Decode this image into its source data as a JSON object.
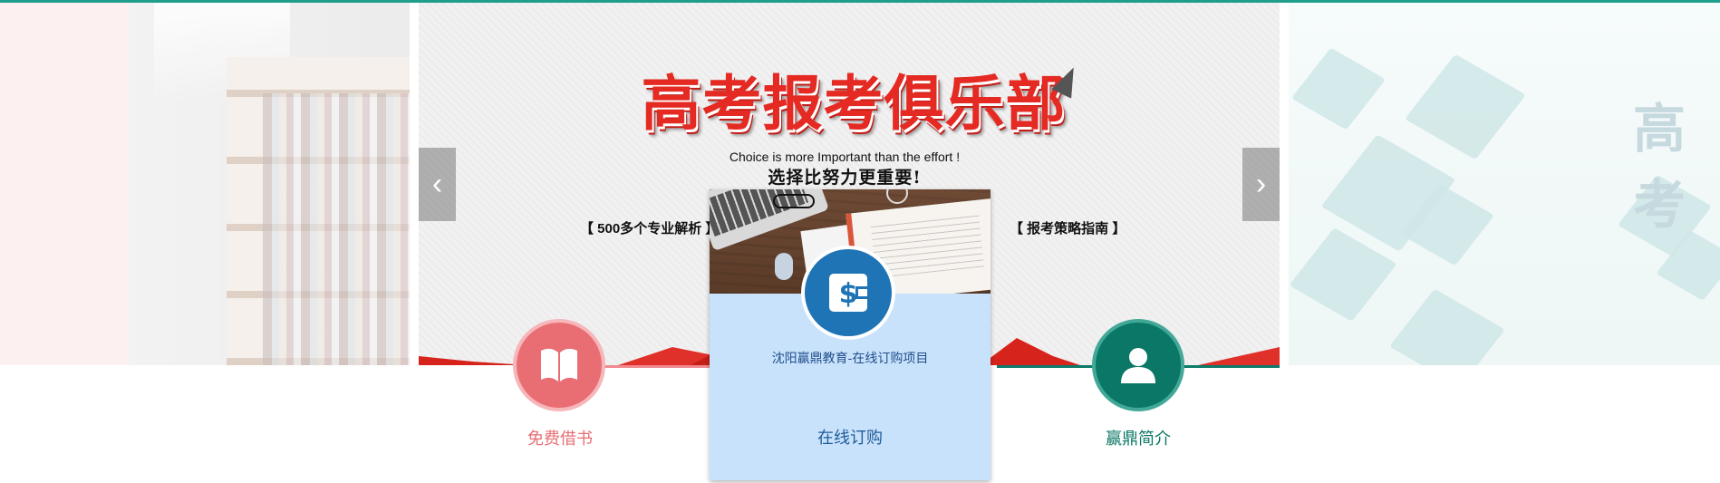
{
  "banner": {
    "title": "高考报考俱乐部",
    "subtitle_en": "Choice is more Important than the effort !",
    "subtitle_zh": "选择比努力更重要!",
    "tag_left": "【 500多个专业解析 】",
    "tag_right": "【 报考策略指南 】",
    "prev_arrow": "‹",
    "next_arrow": "›"
  },
  "right_slide": {
    "title_partial": "高考"
  },
  "nav": {
    "items": [
      {
        "label": "免费借书",
        "icon": "book-icon",
        "color": "#e96e74"
      },
      {
        "label": "在线订购",
        "icon": "dollar-icon",
        "color": "#1e74b5"
      },
      {
        "label": "赢鼎简介",
        "icon": "user-icon",
        "color": "#0b7766"
      }
    ]
  },
  "card": {
    "description": "沈阳赢鼎教育-在线订购项目",
    "label": "在线订购",
    "background": "#c9e2fb"
  },
  "colors": {
    "accent_teal": "#1e9e8b",
    "banner_red": "#e42a22"
  }
}
